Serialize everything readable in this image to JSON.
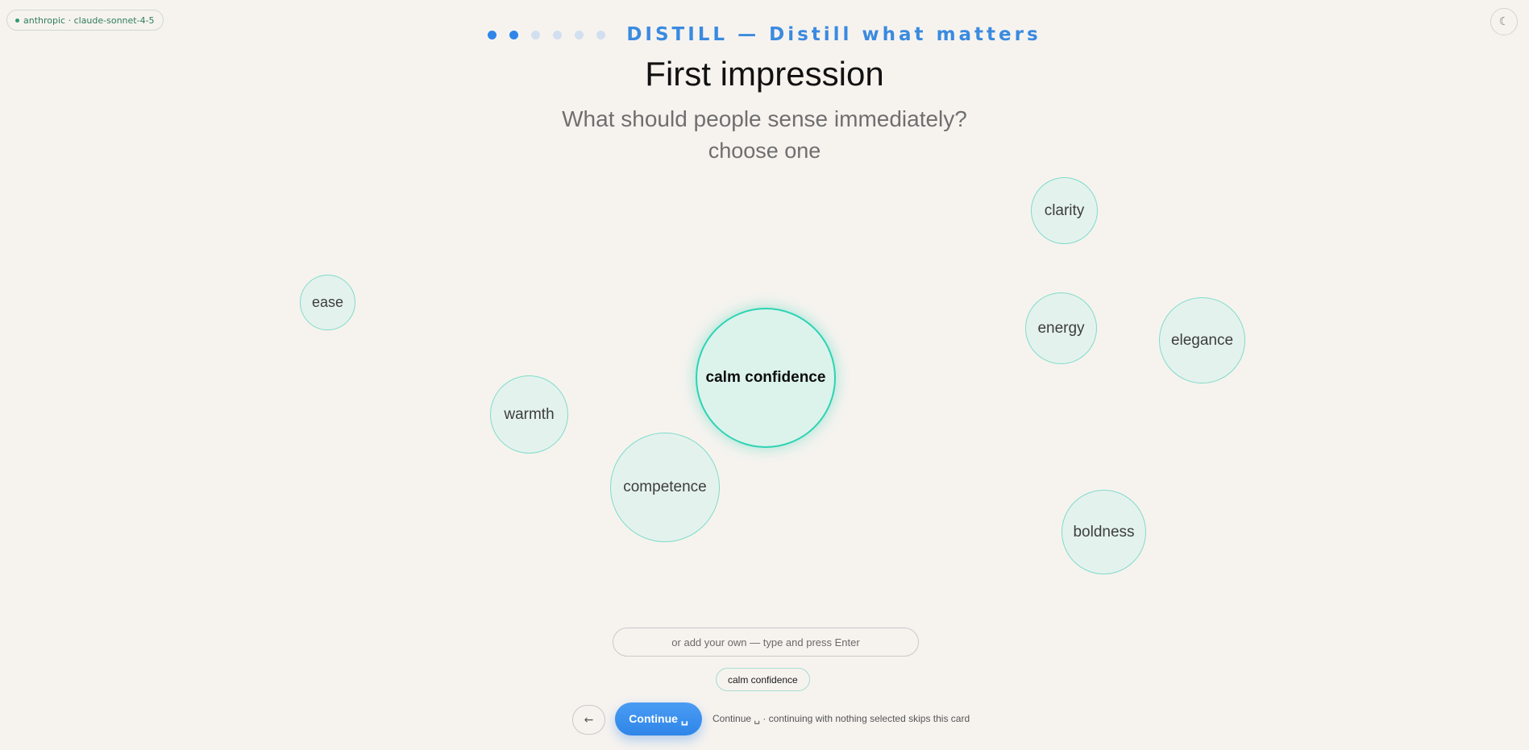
{
  "model_badge": {
    "label": "anthropic · claude-sonnet-4-5"
  },
  "theme_toggle": {
    "icon": "moon-icon",
    "glyph": "☾"
  },
  "progress": {
    "total_steps": 6,
    "current_step": 2
  },
  "brand": {
    "title": "DISTILL — Distill what matters"
  },
  "page_title": "First impression",
  "subtitle": "What should people sense immediately?",
  "hint": "choose one",
  "bubbles": [
    {
      "label": "clarity",
      "selected": false
    },
    {
      "label": "ease",
      "selected": false
    },
    {
      "label": "energy",
      "selected": false
    },
    {
      "label": "elegance",
      "selected": false
    },
    {
      "label": "calm confidence",
      "selected": true
    },
    {
      "label": "warmth",
      "selected": false
    },
    {
      "label": "competence",
      "selected": false
    },
    {
      "label": "boldness",
      "selected": false
    }
  ],
  "custom_input": {
    "placeholder": "or add your own — type and press Enter",
    "value": ""
  },
  "selected_chips": [
    "calm confidence"
  ],
  "nav": {
    "back_label": "←",
    "continue_label": "Continue ␣",
    "continue_note": "Continue ␣ · continuing with nothing selected skips this card"
  },
  "colors": {
    "accent": "#2f86e8",
    "bubble_border": "#7fdcc8",
    "bubble_selected_border": "#2ed3b3",
    "background": "#f6f3ef"
  }
}
